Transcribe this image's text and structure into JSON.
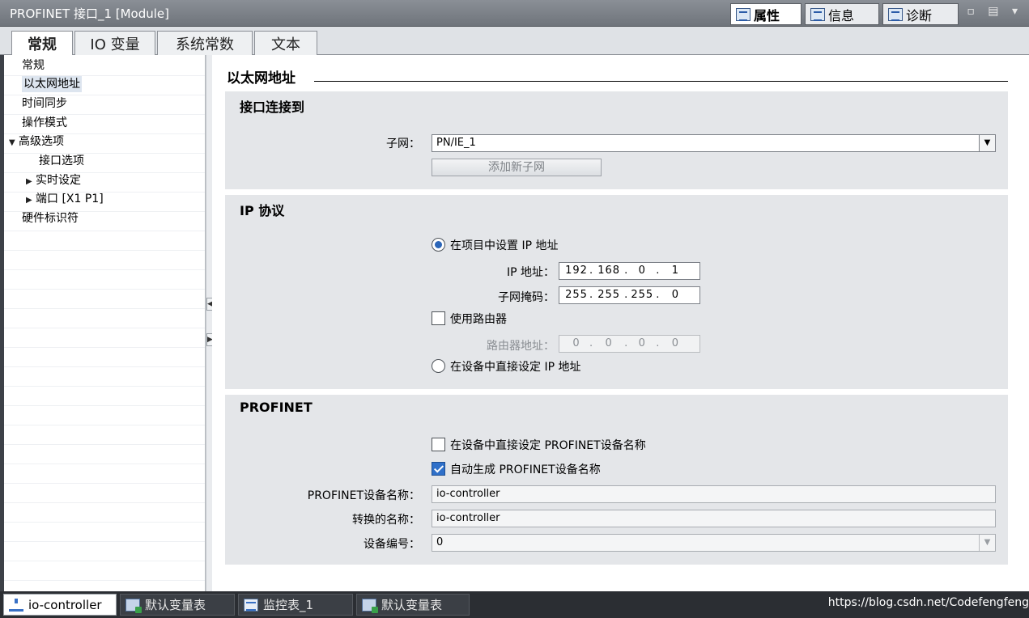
{
  "window": {
    "title": "PROFINET 接口_1 [Module]",
    "panel_tabs": [
      {
        "label": "属性",
        "icon": "properties-icon",
        "active": true
      },
      {
        "label": "信息",
        "icon": "info-icon",
        "active": false
      },
      {
        "label": "诊断",
        "icon": "diagnostics-icon",
        "active": false
      }
    ],
    "controls": "▫ ▤ ▾"
  },
  "tabs": [
    {
      "label": "常规",
      "active": true
    },
    {
      "label": "IO 变量",
      "active": false
    },
    {
      "label": "系统常数",
      "active": false
    },
    {
      "label": "文本",
      "active": false
    }
  ],
  "nav": {
    "items": [
      {
        "label": "常规",
        "indent": 0,
        "arrow": ""
      },
      {
        "label": "以太网地址",
        "indent": 0,
        "arrow": "",
        "selected": true
      },
      {
        "label": "时间同步",
        "indent": 0,
        "arrow": ""
      },
      {
        "label": "操作模式",
        "indent": 0,
        "arrow": ""
      },
      {
        "label": "高级选项",
        "indent": 0,
        "arrow": "▼"
      },
      {
        "label": "接口选项",
        "indent": 2,
        "arrow": ""
      },
      {
        "label": "实时设定",
        "indent": 1,
        "arrow": "▶"
      },
      {
        "label": "端口 [X1 P1]",
        "indent": 1,
        "arrow": "▶"
      },
      {
        "label": "硬件标识符",
        "indent": 0,
        "arrow": ""
      }
    ]
  },
  "main": {
    "heading": "以太网地址",
    "interface_group": {
      "title": "接口连接到",
      "subnet_label": "子网：",
      "subnet_value": "PN/IE_1",
      "add_subnet_button": "添加新子网"
    },
    "ip_group": {
      "title": "IP 协议",
      "set_in_project_label": "在项目中设置 IP 地址",
      "ip_label": "IP 地址：",
      "ip_value": [
        "192",
        "168",
        "0",
        "1"
      ],
      "mask_label": "子网掩码：",
      "mask_value": [
        "255",
        "255",
        "255",
        "0"
      ],
      "use_router_label": "使用路由器",
      "router_label": "路由器地址：",
      "router_value": [
        "0",
        "0",
        "0",
        "0"
      ],
      "set_on_device_label": "在设备中直接设定 IP 地址"
    },
    "profinet_group": {
      "title": "PROFINET",
      "set_name_on_device_label": "在设备中直接设定 PROFINET设备名称",
      "auto_name_label": "自动生成 PROFINET设备名称",
      "device_name_label": "PROFINET设备名称：",
      "device_name_value": "io-controller",
      "converted_name_label": "转换的名称：",
      "converted_name_value": "io-controller",
      "device_number_label": "设备编号：",
      "device_number_value": "0"
    }
  },
  "taskbar": {
    "items": [
      {
        "label": "io-controller",
        "icon": "network-tree-icon",
        "active": true
      },
      {
        "label": "默认变量表",
        "icon": "tag-table-icon",
        "active": false
      },
      {
        "label": "监控表_1",
        "icon": "watch-table-icon",
        "active": false
      },
      {
        "label": "默认变量表",
        "icon": "tag-table-icon",
        "active": false
      }
    ],
    "watermark": "https://blog.csdn.net/Codefengfeng"
  }
}
